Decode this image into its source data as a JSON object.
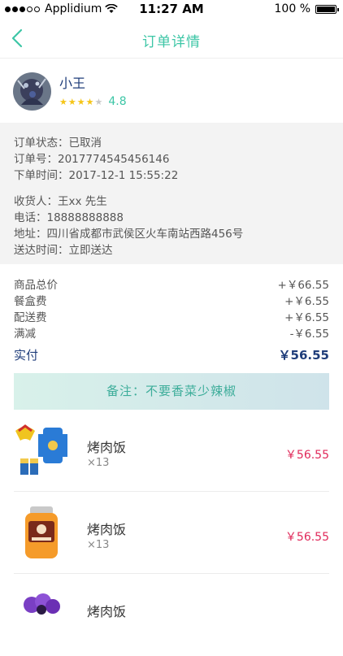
{
  "status_bar": {
    "carrier": "Applidium",
    "time": "11:27 AM",
    "battery_text": "100 %"
  },
  "nav": {
    "title": "订单详情"
  },
  "user": {
    "name": "小王",
    "rating": "4.8",
    "stars_filled": 4,
    "stars_total": 5
  },
  "order": {
    "status": "订单状态：已取消",
    "number": "订单号：2017774545456146",
    "time": "下单时间：2017-12-1 15:55:22",
    "receiver": "收货人：王xx 先生",
    "phone": "电话：18888888888",
    "address": "地址：四川省成都市武侯区火车南站西路456号",
    "delivery": "送达时间：立即送达"
  },
  "prices": [
    {
      "label": "商品总价",
      "value": "+￥66.55"
    },
    {
      "label": "餐盒费",
      "value": "+￥6.55"
    },
    {
      "label": "配送费",
      "value": "+￥6.55"
    },
    {
      "label": "满减",
      "value": "-￥6.55"
    }
  ],
  "paid": {
    "label": "实付",
    "value": "￥56.55"
  },
  "remark": "备注：不要香菜少辣椒",
  "products": [
    {
      "name": "烤肉饭",
      "qty": "×13",
      "price": "￥56.55"
    },
    {
      "name": "烤肉饭",
      "qty": "×13",
      "price": "￥56.55"
    },
    {
      "name": "烤肉饭",
      "qty": "",
      "price": ""
    }
  ],
  "colors": {
    "accent": "#3dc6a6",
    "name": "#1f3d7a",
    "price_red": "#e0295a",
    "star": "#f5c518"
  }
}
